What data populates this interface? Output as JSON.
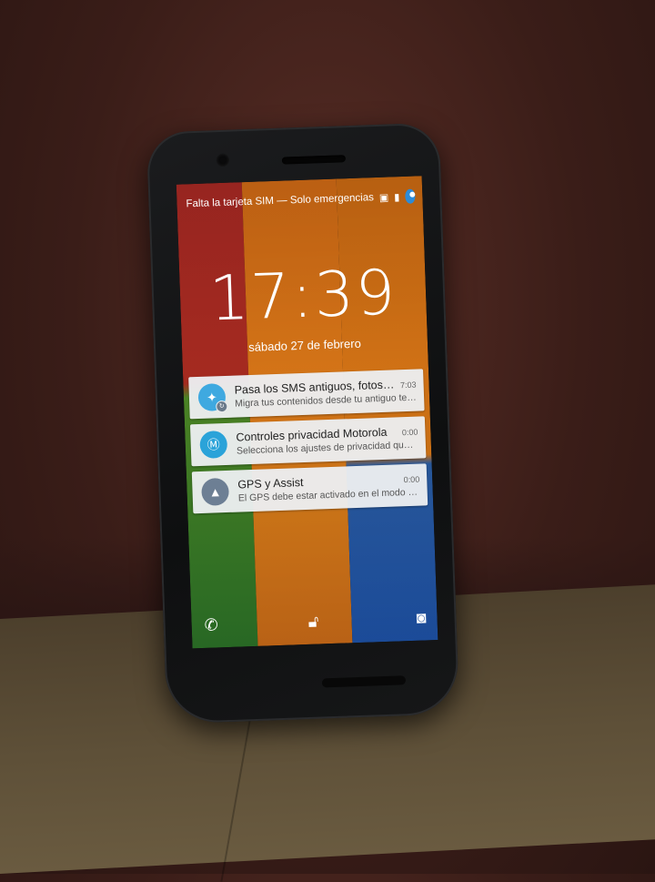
{
  "status_bar": {
    "text": "Falta la tarjeta SIM — Solo emergencias"
  },
  "lockscreen": {
    "time": "17:39",
    "date": "sábado 27 de febrero"
  },
  "notifications": [
    {
      "title": "Pasa los SMS antiguos, fotos y...",
      "time": "7:03",
      "text": "Migra tus contenidos desde tu antiguo telé...",
      "icon": "migrate-icon",
      "color": "#3fa9e0"
    },
    {
      "title": "Controles privacidad Motorola",
      "time": "0:00",
      "text": "Selecciona los ajustes de privacidad que d...",
      "icon": "motorola-logo-icon",
      "color": "#2aa3d9"
    },
    {
      "title": "GPS y Assist",
      "time": "0:00",
      "text": "El GPS debe estar activado en el modo de...",
      "icon": "warning-icon",
      "color": "#6d7f94"
    }
  ],
  "colors": {
    "wallpaper_red": "#b12b25",
    "wallpaper_orange": "#dc7016",
    "wallpaper_green": "#2f7a2a",
    "wallpaper_blue": "#2058b3"
  }
}
